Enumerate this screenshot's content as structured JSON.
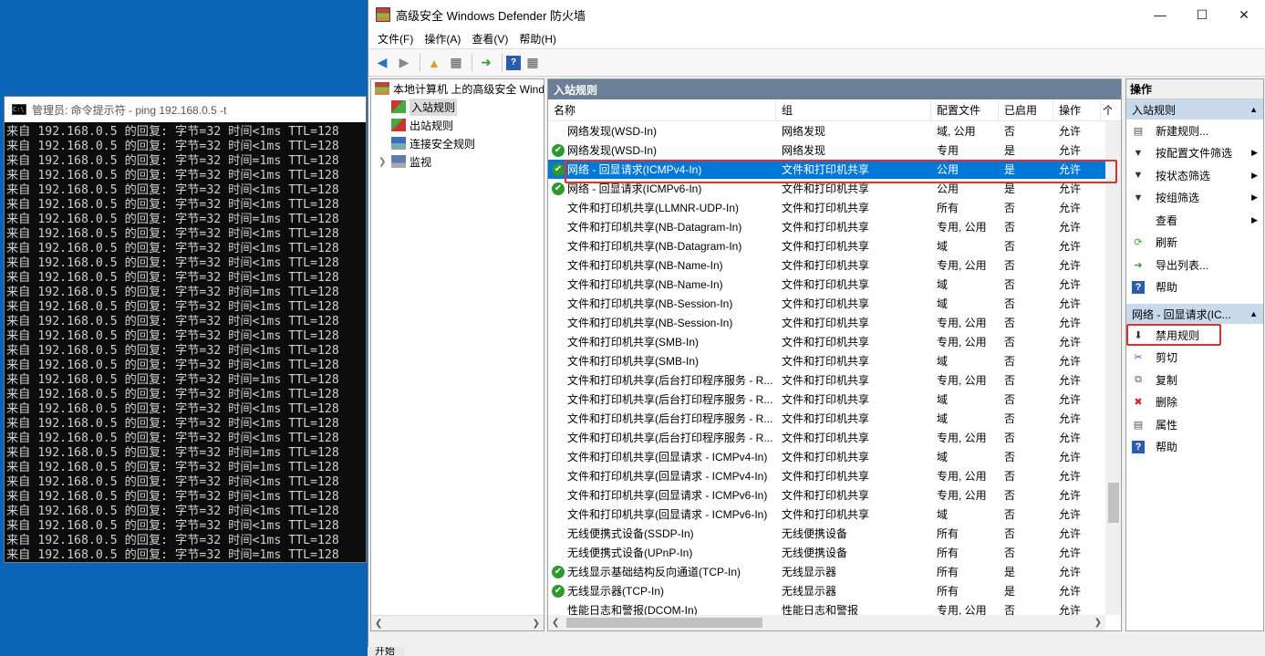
{
  "cmd": {
    "title": "管理员: 命令提示符 - ping  192.168.0.5 -t",
    "lines": [
      "来自 192.168.0.5 的回复: 字节=32 时间<1ms TTL=128",
      "来自 192.168.0.5 的回复: 字节=32 时间<1ms TTL=128",
      "来自 192.168.0.5 的回复: 字节=32 时间=1ms TTL=128",
      "来自 192.168.0.5 的回复: 字节=32 时间<1ms TTL=128",
      "来自 192.168.0.5 的回复: 字节=32 时间<1ms TTL=128",
      "来自 192.168.0.5 的回复: 字节=32 时间<1ms TTL=128",
      "来自 192.168.0.5 的回复: 字节=32 时间=1ms TTL=128",
      "来自 192.168.0.5 的回复: 字节=32 时间<1ms TTL=128",
      "来自 192.168.0.5 的回复: 字节=32 时间<1ms TTL=128",
      "来自 192.168.0.5 的回复: 字节=32 时间<1ms TTL=128",
      "来自 192.168.0.5 的回复: 字节=32 时间<1ms TTL=128",
      "来自 192.168.0.5 的回复: 字节=32 时间=1ms TTL=128",
      "来自 192.168.0.5 的回复: 字节=32 时间<1ms TTL=128",
      "来自 192.168.0.5 的回复: 字节=32 时间<1ms TTL=128",
      "来自 192.168.0.5 的回复: 字节=32 时间<1ms TTL=128",
      "来自 192.168.0.5 的回复: 字节=32 时间<1ms TTL=128",
      "来自 192.168.0.5 的回复: 字节=32 时间<1ms TTL=128",
      "来自 192.168.0.5 的回复: 字节=32 时间=1ms TTL=128",
      "来自 192.168.0.5 的回复: 字节=32 时间<1ms TTL=128",
      "来自 192.168.0.5 的回复: 字节=32 时间<1ms TTL=128",
      "来自 192.168.0.5 的回复: 字节=32 时间<1ms TTL=128",
      "来自 192.168.0.5 的回复: 字节=32 时间<1ms TTL=128",
      "来自 192.168.0.5 的回复: 字节=32 时间=1ms TTL=128",
      "来自 192.168.0.5 的回复: 字节=32 时间=1ms TTL=128",
      "来自 192.168.0.5 的回复: 字节=32 时间<1ms TTL=128",
      "来自 192.168.0.5 的回复: 字节=32 时间<1ms TTL=128",
      "来自 192.168.0.5 的回复: 字节=32 时间<1ms TTL=128",
      "来自 192.168.0.5 的回复: 字节=32 时间<1ms TTL=128",
      "来自 192.168.0.5 的回复: 字节=32 时间<1ms TTL=128",
      "来自 192.168.0.5 的回复: 字节=32 时间=1ms TTL=128"
    ]
  },
  "fw": {
    "title": "高级安全 Windows Defender 防火墙",
    "menu": [
      "文件(F)",
      "操作(A)",
      "查看(V)",
      "帮助(H)"
    ],
    "tree": [
      {
        "label": "本地计算机 上的高级安全 Windows Defender 防火墙",
        "icon": "firewall-icon"
      },
      {
        "label": "入站规则",
        "icon": "inbound-rules-icon"
      },
      {
        "label": "出站规则",
        "icon": "outbound-rules-icon"
      },
      {
        "label": "连接安全规则",
        "icon": "connection-security-icon"
      },
      {
        "label": "监视",
        "icon": "monitor-icon"
      }
    ],
    "center_title": "入站规则",
    "columns": [
      "名称",
      "组",
      "配置文件",
      "已启用",
      "操作",
      "个"
    ],
    "rules": [
      {
        "name": "网络发现(WSD-In)",
        "group": "网络发现",
        "profile": "域, 公用",
        "enabled": "否",
        "action": "允许",
        "on": false
      },
      {
        "name": "网络发现(WSD-In)",
        "group": "网络发现",
        "profile": "专用",
        "enabled": "是",
        "action": "允许",
        "on": true
      },
      {
        "name": "网络 - 回显请求(ICMPv4-In)",
        "group": "文件和打印机共享",
        "profile": "公用",
        "enabled": "是",
        "action": "允许",
        "on": true
      },
      {
        "name": "网络 - 回显请求(ICMPv6-In)",
        "group": "文件和打印机共享",
        "profile": "公用",
        "enabled": "是",
        "action": "允许",
        "on": true
      },
      {
        "name": "文件和打印机共享(LLMNR-UDP-In)",
        "group": "文件和打印机共享",
        "profile": "所有",
        "enabled": "否",
        "action": "允许",
        "on": false
      },
      {
        "name": "文件和打印机共享(NB-Datagram-In)",
        "group": "文件和打印机共享",
        "profile": "专用, 公用",
        "enabled": "否",
        "action": "允许",
        "on": false
      },
      {
        "name": "文件和打印机共享(NB-Datagram-In)",
        "group": "文件和打印机共享",
        "profile": "域",
        "enabled": "否",
        "action": "允许",
        "on": false
      },
      {
        "name": "文件和打印机共享(NB-Name-In)",
        "group": "文件和打印机共享",
        "profile": "专用, 公用",
        "enabled": "否",
        "action": "允许",
        "on": false
      },
      {
        "name": "文件和打印机共享(NB-Name-In)",
        "group": "文件和打印机共享",
        "profile": "域",
        "enabled": "否",
        "action": "允许",
        "on": false
      },
      {
        "name": "文件和打印机共享(NB-Session-In)",
        "group": "文件和打印机共享",
        "profile": "域",
        "enabled": "否",
        "action": "允许",
        "on": false
      },
      {
        "name": "文件和打印机共享(NB-Session-In)",
        "group": "文件和打印机共享",
        "profile": "专用, 公用",
        "enabled": "否",
        "action": "允许",
        "on": false
      },
      {
        "name": "文件和打印机共享(SMB-In)",
        "group": "文件和打印机共享",
        "profile": "专用, 公用",
        "enabled": "否",
        "action": "允许",
        "on": false
      },
      {
        "name": "文件和打印机共享(SMB-In)",
        "group": "文件和打印机共享",
        "profile": "域",
        "enabled": "否",
        "action": "允许",
        "on": false
      },
      {
        "name": "文件和打印机共享(后台打印程序服务 - R...",
        "group": "文件和打印机共享",
        "profile": "专用, 公用",
        "enabled": "否",
        "action": "允许",
        "on": false
      },
      {
        "name": "文件和打印机共享(后台打印程序服务 - R...",
        "group": "文件和打印机共享",
        "profile": "域",
        "enabled": "否",
        "action": "允许",
        "on": false
      },
      {
        "name": "文件和打印机共享(后台打印程序服务 - R...",
        "group": "文件和打印机共享",
        "profile": "域",
        "enabled": "否",
        "action": "允许",
        "on": false
      },
      {
        "name": "文件和打印机共享(后台打印程序服务 - R...",
        "group": "文件和打印机共享",
        "profile": "专用, 公用",
        "enabled": "否",
        "action": "允许",
        "on": false
      },
      {
        "name": "文件和打印机共享(回显请求 - ICMPv4-In)",
        "group": "文件和打印机共享",
        "profile": "域",
        "enabled": "否",
        "action": "允许",
        "on": false
      },
      {
        "name": "文件和打印机共享(回显请求 - ICMPv4-In)",
        "group": "文件和打印机共享",
        "profile": "专用, 公用",
        "enabled": "否",
        "action": "允许",
        "on": false
      },
      {
        "name": "文件和打印机共享(回显请求 - ICMPv6-In)",
        "group": "文件和打印机共享",
        "profile": "专用, 公用",
        "enabled": "否",
        "action": "允许",
        "on": false
      },
      {
        "name": "文件和打印机共享(回显请求 - ICMPv6-In)",
        "group": "文件和打印机共享",
        "profile": "域",
        "enabled": "否",
        "action": "允许",
        "on": false
      },
      {
        "name": "无线便携式设备(SSDP-In)",
        "group": "无线便携设备",
        "profile": "所有",
        "enabled": "否",
        "action": "允许",
        "on": false
      },
      {
        "name": "无线便携式设备(UPnP-In)",
        "group": "无线便携设备",
        "profile": "所有",
        "enabled": "否",
        "action": "允许",
        "on": false
      },
      {
        "name": "无线显示基础结构反向通道(TCP-In)",
        "group": "无线显示器",
        "profile": "所有",
        "enabled": "是",
        "action": "允许",
        "on": true
      },
      {
        "name": "无线显示器(TCP-In)",
        "group": "无线显示器",
        "profile": "所有",
        "enabled": "是",
        "action": "允许",
        "on": true
      },
      {
        "name": "性能日志和警报(DCOM-In)",
        "group": "性能日志和警报",
        "profile": "专用, 公用",
        "enabled": "否",
        "action": "允许",
        "on": false
      }
    ],
    "actions_title": "操作",
    "group1_title": "入站规则",
    "group1_items": [
      {
        "label": "新建规则...",
        "icon": "new-rule-icon",
        "arrow": false
      },
      {
        "label": "按配置文件筛选",
        "icon": "filter-icon",
        "arrow": true
      },
      {
        "label": "按状态筛选",
        "icon": "filter-icon",
        "arrow": true
      },
      {
        "label": "按组筛选",
        "icon": "filter-icon",
        "arrow": true
      },
      {
        "label": "查看",
        "icon": "",
        "arrow": true
      },
      {
        "label": "刷新",
        "icon": "refresh-icon",
        "arrow": false
      },
      {
        "label": "导出列表...",
        "icon": "export-icon",
        "arrow": false
      },
      {
        "label": "帮助",
        "icon": "help-icon",
        "arrow": false
      }
    ],
    "group2_title": "网络 - 回显请求(IC...",
    "group2_items": [
      {
        "label": "禁用规则",
        "icon": "disable-rule-icon"
      },
      {
        "label": "剪切",
        "icon": "cut-icon"
      },
      {
        "label": "复制",
        "icon": "copy-icon"
      },
      {
        "label": "删除",
        "icon": "delete-icon"
      },
      {
        "label": "属性",
        "icon": "properties-icon"
      },
      {
        "label": "帮助",
        "icon": "help-icon"
      }
    ]
  },
  "taskbar_label": "开始"
}
